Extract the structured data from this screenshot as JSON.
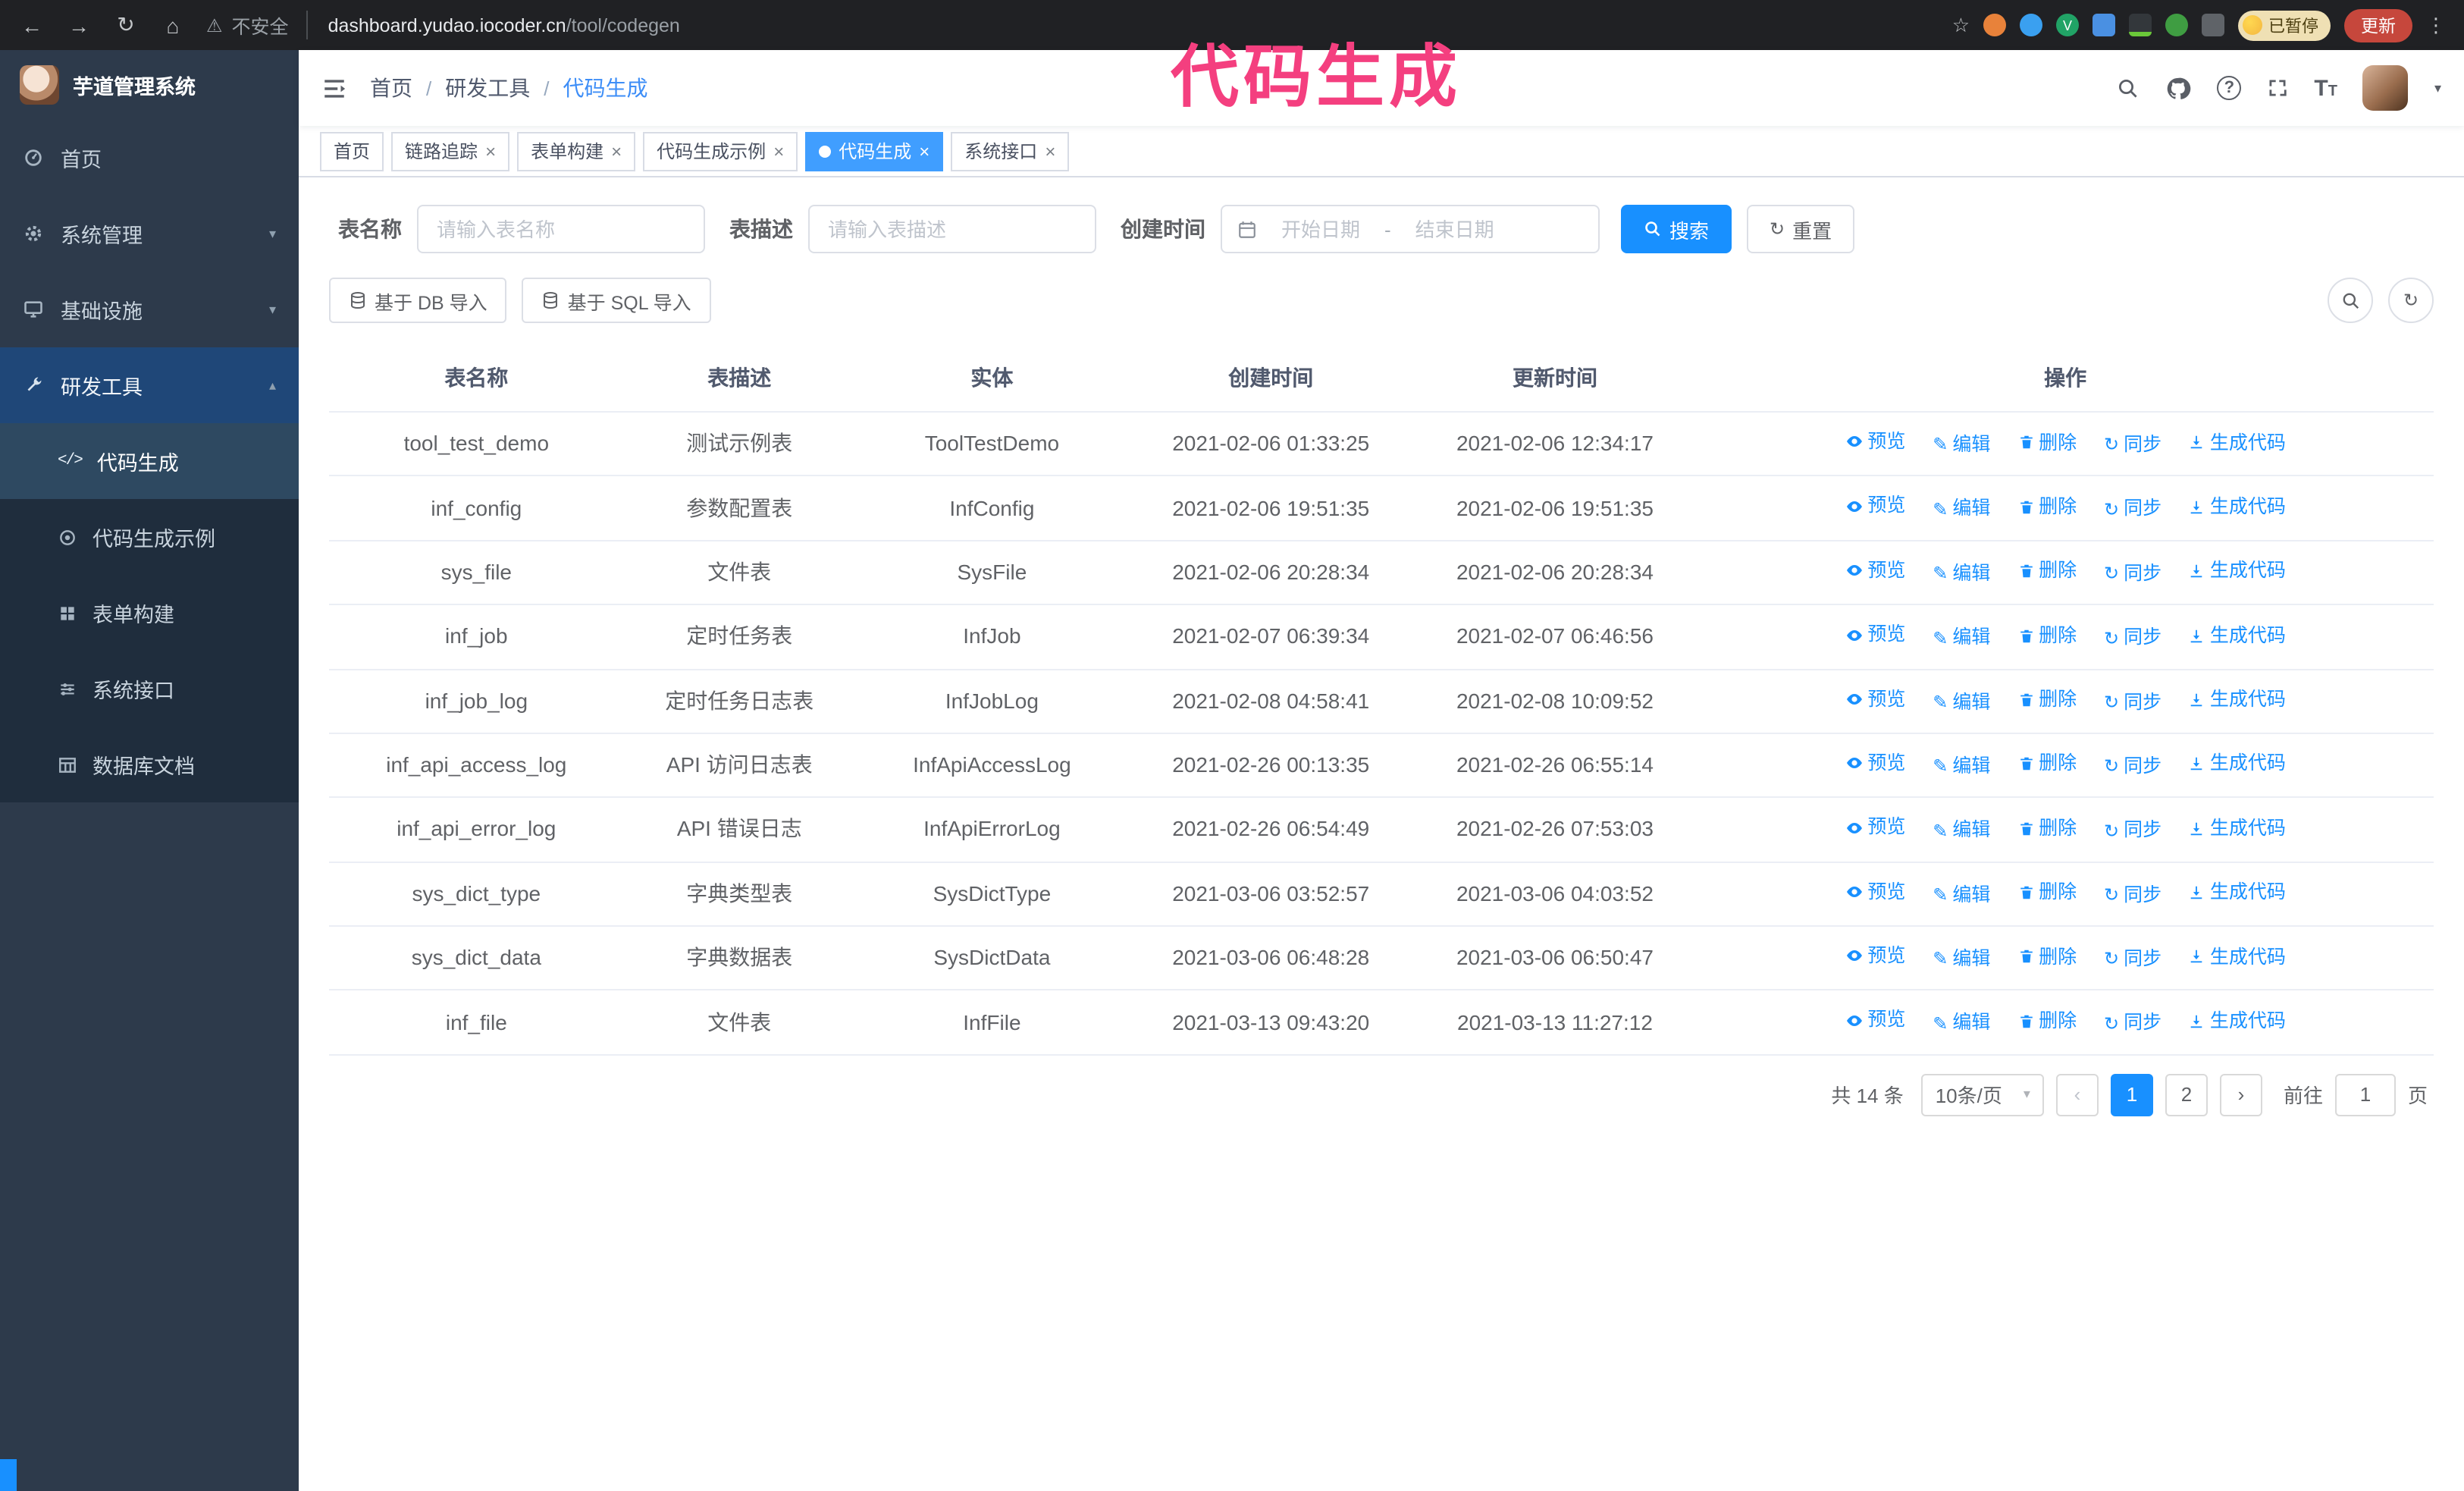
{
  "annotation": {
    "text": "代码生成"
  },
  "browser": {
    "security_label": "不安全",
    "url_host": "dashboard.yudao.iocoder.cn",
    "url_path": "/tool/codegen",
    "paused_badge": "已暂停",
    "update_button": "更新"
  },
  "sidebar": {
    "logo_title": "芋道管理系统",
    "items": [
      {
        "label": "首页"
      },
      {
        "label": "系统管理"
      },
      {
        "label": "基础设施"
      },
      {
        "label": "研发工具"
      }
    ],
    "sub_items": [
      {
        "label": "代码生成"
      },
      {
        "label": "代码生成示例"
      },
      {
        "label": "表单构建"
      },
      {
        "label": "系统接口"
      },
      {
        "label": "数据库文档"
      }
    ]
  },
  "header": {
    "breadcrumb": [
      "首页",
      "研发工具",
      "代码生成"
    ],
    "separator": "/"
  },
  "tabs": [
    {
      "label": "首页"
    },
    {
      "label": "链路追踪"
    },
    {
      "label": "表单构建"
    },
    {
      "label": "代码生成示例"
    },
    {
      "label": "代码生成"
    },
    {
      "label": "系统接口"
    }
  ],
  "filters": {
    "name_label": "表名称",
    "name_placeholder": "请输入表名称",
    "desc_label": "表描述",
    "desc_placeholder": "请输入表描述",
    "time_label": "创建时间",
    "start_placeholder": "开始日期",
    "range_separator": "-",
    "end_placeholder": "结束日期",
    "search_label": "搜索",
    "reset_label": "重置"
  },
  "toolbar": {
    "import_db_label": "基于 DB 导入",
    "import_sql_label": "基于 SQL 导入"
  },
  "table": {
    "columns": [
      "表名称",
      "表描述",
      "实体",
      "创建时间",
      "更新时间",
      "操作"
    ],
    "actions": [
      "预览",
      "编辑",
      "删除",
      "同步",
      "生成代码"
    ],
    "rows": [
      {
        "name": "tool_test_demo",
        "desc": "测试示例表",
        "entity": "ToolTestDemo",
        "created": "2021-02-06 01:33:25",
        "updated": "2021-02-06 12:34:17"
      },
      {
        "name": "inf_config",
        "desc": "参数配置表",
        "entity": "InfConfig",
        "created": "2021-02-06 19:51:35",
        "updated": "2021-02-06 19:51:35"
      },
      {
        "name": "sys_file",
        "desc": "文件表",
        "entity": "SysFile",
        "created": "2021-02-06 20:28:34",
        "updated": "2021-02-06 20:28:34"
      },
      {
        "name": "inf_job",
        "desc": "定时任务表",
        "entity": "InfJob",
        "created": "2021-02-07 06:39:34",
        "updated": "2021-02-07 06:46:56"
      },
      {
        "name": "inf_job_log",
        "desc": "定时任务日志表",
        "entity": "InfJobLog",
        "created": "2021-02-08 04:58:41",
        "updated": "2021-02-08 10:09:52"
      },
      {
        "name": "inf_api_access_log",
        "desc": "API 访问日志表",
        "entity": "InfApiAccessLog",
        "created": "2021-02-26 00:13:35",
        "updated": "2021-02-26 06:55:14"
      },
      {
        "name": "inf_api_error_log",
        "desc": "API 错误日志",
        "entity": "InfApiErrorLog",
        "created": "2021-02-26 06:54:49",
        "updated": "2021-02-26 07:53:03"
      },
      {
        "name": "sys_dict_type",
        "desc": "字典类型表",
        "entity": "SysDictType",
        "created": "2021-03-06 03:52:57",
        "updated": "2021-03-06 04:03:52"
      },
      {
        "name": "sys_dict_data",
        "desc": "字典数据表",
        "entity": "SysDictData",
        "created": "2021-03-06 06:48:28",
        "updated": "2021-03-06 06:50:47"
      },
      {
        "name": "inf_file",
        "desc": "文件表",
        "entity": "InfFile",
        "created": "2021-03-13 09:43:20",
        "updated": "2021-03-13 11:27:12"
      }
    ]
  },
  "pagination": {
    "total_label": "共 14 条",
    "page_size_label": "10条/页",
    "page_1": "1",
    "page_2": "2",
    "goto_label": "前往",
    "goto_value": "1",
    "goto_unit": "页"
  }
}
